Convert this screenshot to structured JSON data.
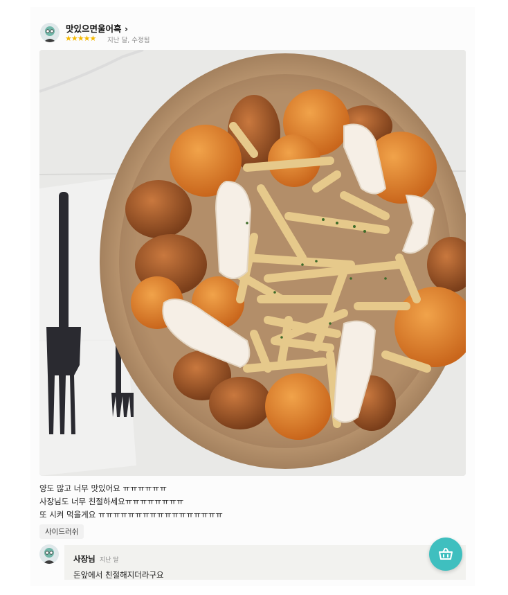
{
  "review": {
    "author": "맛있으면울어흑",
    "author_chevron": "›",
    "stars": "★★★★★",
    "time_label": "지난 달, 수정됨",
    "lines": [
      "양도 많고 너무 맛있어요 ㅠㅠㅠㅠㅠㅠ",
      "사장님도 너무 친절하세요ㅠㅠㅠㅠㅠㅠㅠㅠ",
      "또 시켜 먹을게요 ㅠㅠㅠㅠㅠㅠㅠㅠㅠㅠㅠㅠㅠㅠㅠㅠㅠ"
    ],
    "menu_tag": "사이드러쉬"
  },
  "owner_reply": {
    "name": "사장님",
    "time_label": "지난 달",
    "text": "돈앞에서 친절해지더라구요"
  },
  "colors": {
    "star": "#f5b800",
    "fab": "#3fbfbf"
  },
  "icons": {
    "fab": "basket-icon"
  }
}
